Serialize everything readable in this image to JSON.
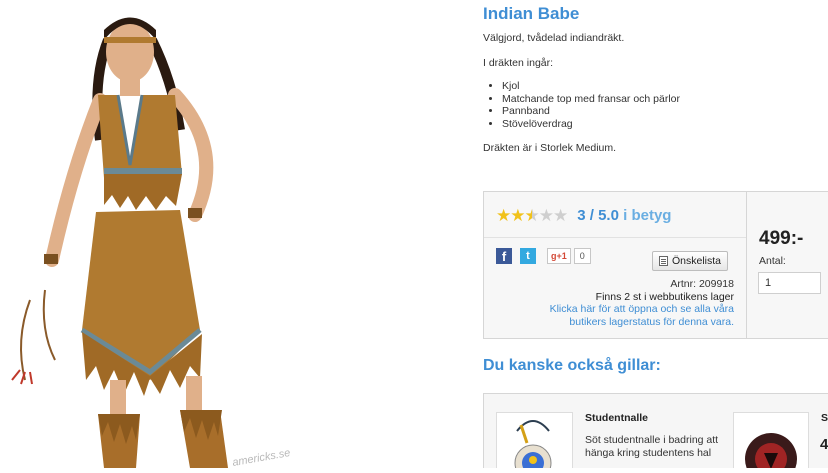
{
  "product": {
    "title": "Indian Babe",
    "description": "Välgjord, tvådelad indiandräkt.",
    "includes_label": "I dräkten ingår:",
    "includes": [
      "Kjol",
      "Matchande top med fransar och pärlor",
      "Pannband",
      "Stövelöverdrag"
    ],
    "size_note": "Dräkten är i Storlek Medium.",
    "watermark": "americks.se"
  },
  "buybox": {
    "rating": {
      "score": 3,
      "max": 5,
      "text_score": "3 / 5.0",
      "text_suffix": "i betyg",
      "stars": [
        "full",
        "full",
        "half",
        "empty",
        "empty"
      ]
    },
    "social": {
      "facebook_glyph": "f",
      "twitter_glyph": "t",
      "gplus_label": "g+1",
      "gplus_count": "0"
    },
    "wishlist_label": "Önskelista",
    "artnr": "Artnr: 209918",
    "stock": "Finns 2 st i webbutikens lager",
    "stock_link": "Klicka här för att öppna och se alla våra butikers lagerstatus för denna vara.",
    "price": "499:-",
    "qty_label": "Antal:",
    "qty_value": "1"
  },
  "related": {
    "heading": "Du kanske också gillar:",
    "items": [
      {
        "name": "Studentnalle",
        "description": "Söt studentnalle i badring att hänga kring studentens hal"
      },
      {
        "name": "S",
        "price": "4"
      }
    ]
  },
  "colors": {
    "accent": "#3f8ed4",
    "star": "#f1c21a",
    "costume": "#b07a30"
  }
}
